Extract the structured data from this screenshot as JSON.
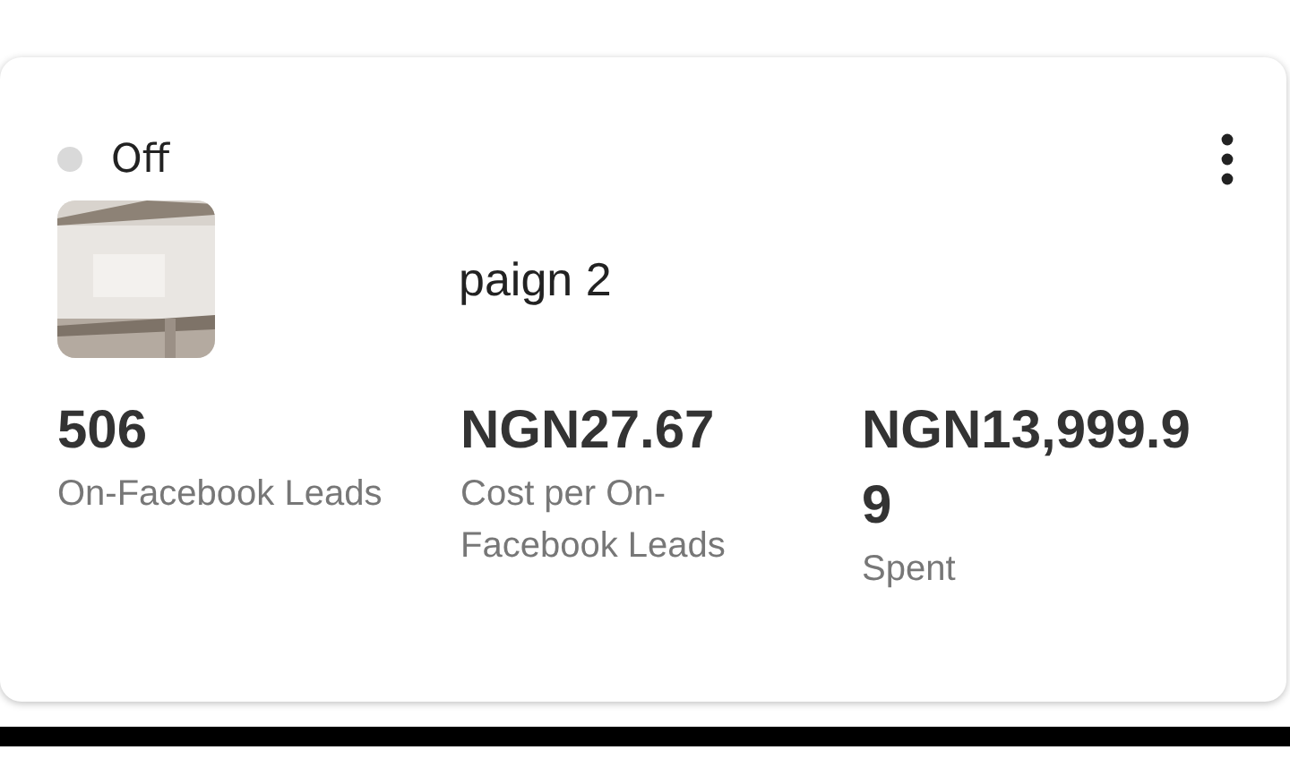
{
  "campaign": {
    "status": {
      "label": "Off",
      "on": false
    },
    "title": "paign 2",
    "metrics": [
      {
        "value": "506",
        "label": "On-Facebook Leads"
      },
      {
        "value": "NGN27.67",
        "label": "Cost per On-Facebook Leads"
      },
      {
        "value": "NGN13,999.99",
        "label": "Spent"
      }
    ]
  }
}
